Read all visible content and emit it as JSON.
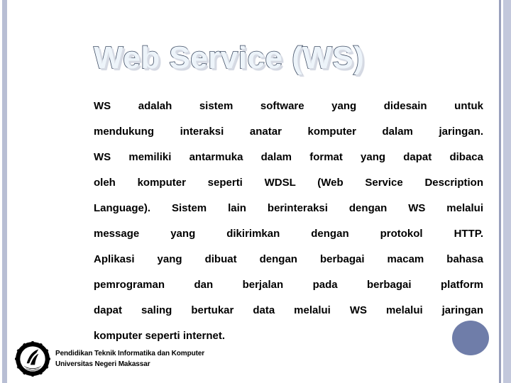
{
  "slide": {
    "title": "Web Service (WS)",
    "body_lines": [
      "WS adalah sistem software yang didesain untuk",
      "mendukung interaksi anatar komputer dalam jaringan.",
      "WS memiliki antarmuka dalam format yang dapat dibaca",
      "oleh komputer seperti WDSL (Web Service Description",
      "Language). Sistem lain berinteraksi dengan WS melalui",
      "message yang dikirimkan dengan protokol HTTP.",
      "Aplikasi yang dibuat dengan berbagai macam bahasa",
      "pemrograman dan berjalan pada berbagai platform",
      "dapat saling bertukar data melalui WS melalui jaringan",
      "komputer seperti internet."
    ]
  },
  "footer": {
    "logo_name": "universitas-negeri-makassar-logo",
    "line1": "Pendidikan Teknik Informatika dan Komputer",
    "line2": "Universitas Negeri Makassar"
  },
  "decor": {
    "left_bar_color": "#b8bed4",
    "right_thin_bar_color": "#9aa1bd",
    "right_wide_bar_color": "#c3c8dc",
    "circle_color": "#6f7da9",
    "title_fill_color": "#edf4fa",
    "title_outline_color": "#3e4c63",
    "title_shadow_color": "#d7dbe4",
    "body_text_color": "#000000"
  }
}
